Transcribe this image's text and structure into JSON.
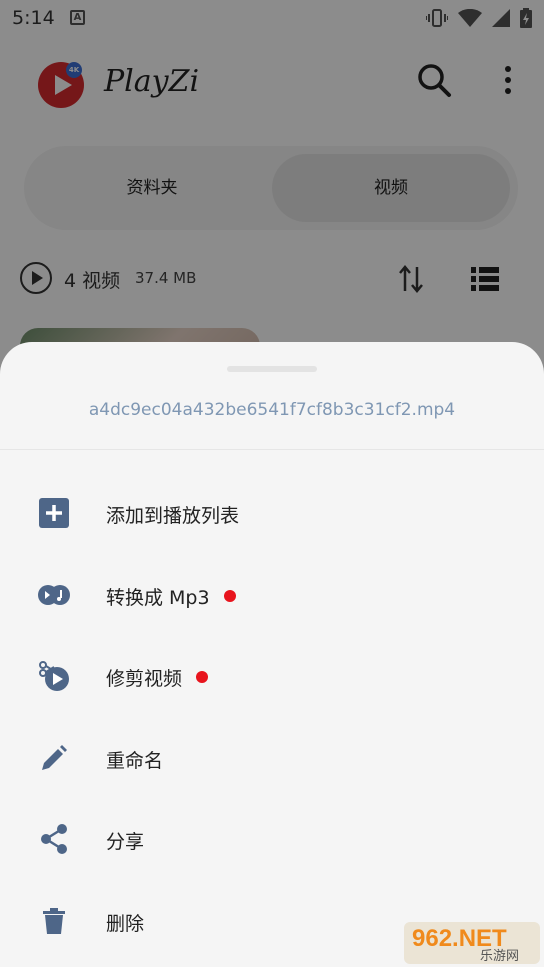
{
  "status_bar": {
    "time": "5:14",
    "notif_letter": "A"
  },
  "header": {
    "app_name": "PlayZi",
    "logo_badge": "4K"
  },
  "tabs": [
    {
      "label": "资料夹"
    },
    {
      "label": "视频",
      "selected": true
    }
  ],
  "info": {
    "count": "4 视频",
    "size": "37.4 MB"
  },
  "sheet": {
    "filename": "a4dc9ec04a432be6541f7cf8b3c31cf2.mp4",
    "items": [
      {
        "label": "添加到播放列表",
        "icon": "add-to-playlist-icon",
        "badge": false
      },
      {
        "label": "转换成 Mp3",
        "icon": "convert-mp3-icon",
        "badge": true
      },
      {
        "label": "修剪视频",
        "icon": "trim-video-icon",
        "badge": true
      },
      {
        "label": "重命名",
        "icon": "rename-icon",
        "badge": false
      },
      {
        "label": "分享",
        "icon": "share-icon",
        "badge": false
      },
      {
        "label": "删除",
        "icon": "delete-icon",
        "badge": false
      }
    ]
  },
  "watermark": {
    "text": "962.NET",
    "subtext": "乐游网"
  },
  "colors": {
    "accent_red": "#e8141d",
    "icon_blue": "#4e6688",
    "filename_blue": "#7f97b3",
    "logo_red": "#d62a2f"
  }
}
